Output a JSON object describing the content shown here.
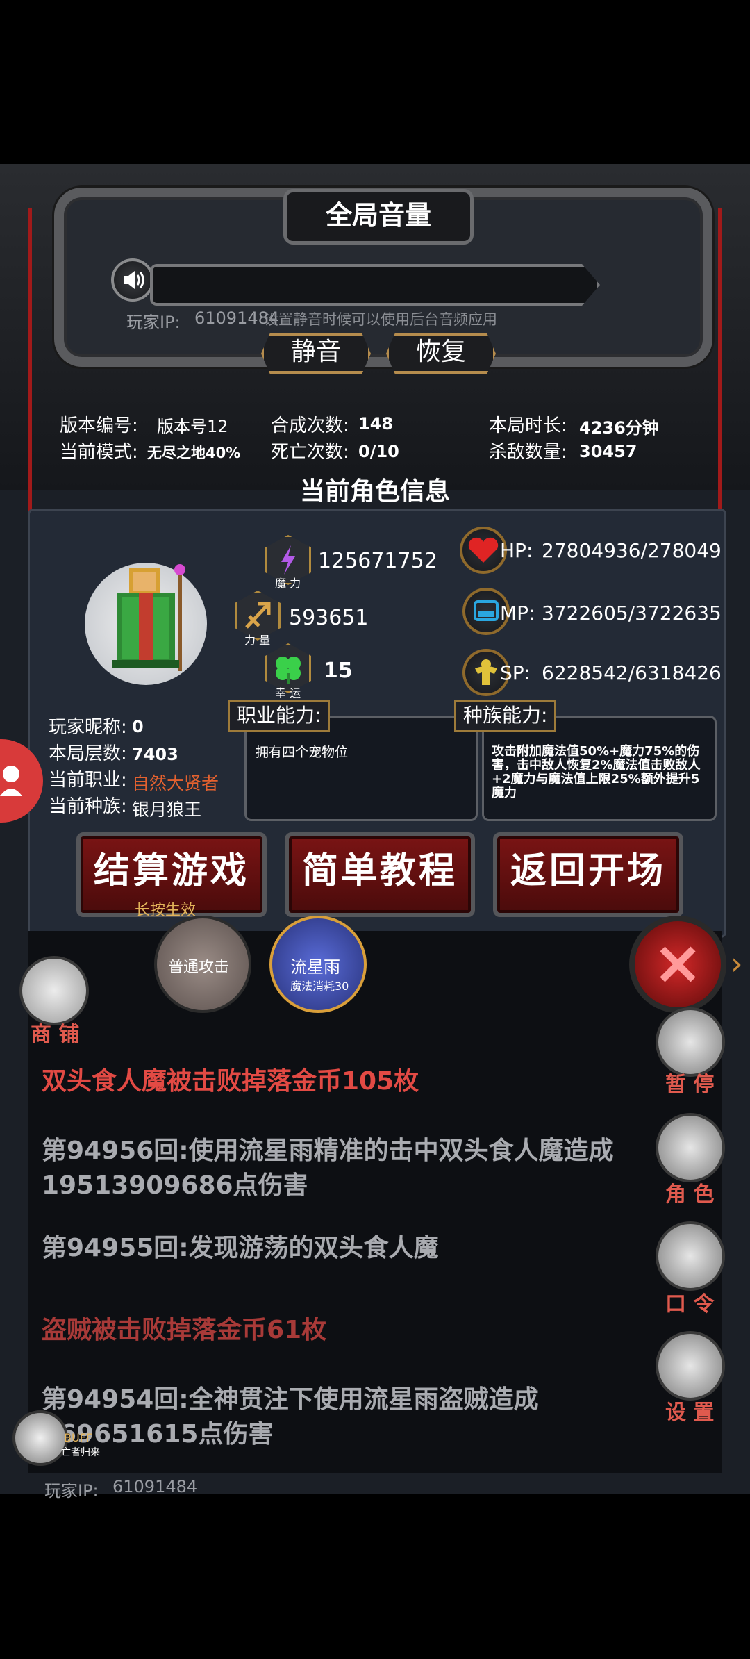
{
  "volume_panel": {
    "title": "全局音量",
    "player_ip_label": "玩家IP:",
    "player_ip_value": "61091484",
    "hint": "设置静音时候可以使用后台音频应用",
    "mute_button": "静音",
    "restore_button": "恢复"
  },
  "stats": {
    "version_label": "版本编号:",
    "version_value": "版本号12",
    "mode_label": "当前模式:",
    "mode_value": "无尽之地40%",
    "synth_label": "合成次数:",
    "synth_value": "148",
    "death_label": "死亡次数:",
    "death_value": "0/10",
    "duration_label": "本局时长:",
    "duration_value": "4236分钟",
    "kills_label": "杀敌数量:",
    "kills_value": "30457"
  },
  "character": {
    "section_title": "当前角色信息",
    "magic_value": "125671752",
    "magic_label": "魔 力",
    "strength_value": "593651",
    "strength_label": "力 量",
    "luck_value": "15",
    "luck_label": "幸 运",
    "hp_label": "HP:",
    "hp_value": "27804936/278049",
    "mp_label": "MP:",
    "mp_value": "3722605/3722635",
    "sp_label": "SP:",
    "sp_value": "6228542/6318426",
    "nickname_label": "玩家昵称:",
    "nickname_value": "0",
    "floor_label": "本局层数:",
    "floor_value": "7403",
    "job_label": "当前职业:",
    "job_value": "自然大贤者",
    "race_label": "当前种族:",
    "race_value": "银月狼王",
    "job_ability_title": "职业能力:",
    "job_ability_text": "拥有四个宠物位",
    "race_ability_title": "种族能力:",
    "race_ability_text": "攻击附加魔法值50%+魔力75%的伤害，击中敌人恢复2%魔法值击败敌人+2魔力与魔法值上限25%额外提升5魔力"
  },
  "actions": {
    "settle_button": "结算游戏",
    "settle_sub": "长按生效",
    "tutorial_button": "简单教程",
    "back_button": "返回开场"
  },
  "skills": {
    "normal_attack": "普通攻击",
    "meteor": "流星雨",
    "meteor_cost": "魔法消耗30"
  },
  "side_menu": {
    "shop": "商 铺",
    "pause": "暂 停",
    "role": "角 色",
    "command": "口 令",
    "settings": "设 置"
  },
  "log": [
    {
      "text": "双头食人魔被击败掉落金币105枚",
      "color": "#e24a44"
    },
    {
      "text": "第94956回:使用流星雨精准的击中双头食人魔造成19513909686点伤害",
      "color": "#a9abb0"
    },
    {
      "text": "第94955回:发现游荡的双头食人魔",
      "color": "#a9abb0"
    },
    {
      "text": "盗贼被击败掉落金币61枚",
      "color": "#a83a38"
    },
    {
      "text": "第94954回:全神贯注下使用流星雨盗贼造成269651615点伤害",
      "color": "#a9abb0"
    }
  ],
  "buff": {
    "label": "BUFF",
    "sub": "亡者归来"
  },
  "footer": {
    "ip_label": "玩家IP:",
    "ip_value": "61091484"
  }
}
